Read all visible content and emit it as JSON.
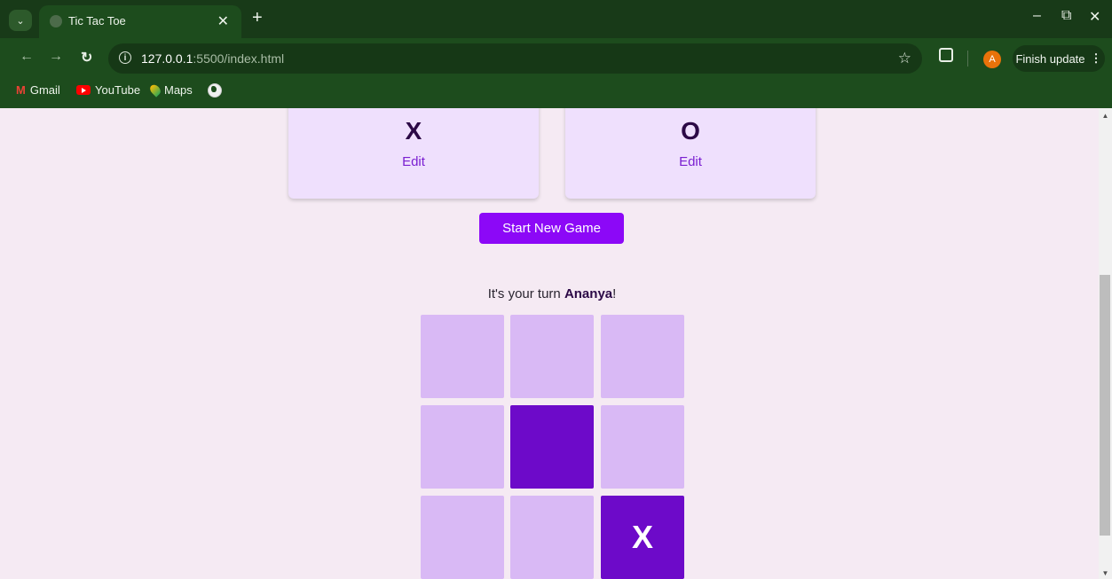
{
  "browser": {
    "tab_title": "Tic Tac Toe",
    "url_host": "127.0.0.1",
    "url_path": ":5500/index.html",
    "finish_update_label": "Finish update",
    "avatar_letter": "A",
    "bookmarks": [
      {
        "label": "Gmail",
        "icon": "gmail-icon"
      },
      {
        "label": "YouTube",
        "icon": "youtube-icon"
      },
      {
        "label": "Maps",
        "icon": "maps-icon"
      },
      {
        "label": "",
        "icon": "globe-icon"
      }
    ],
    "theme_color": "#1d4c1d"
  },
  "page": {
    "players": [
      {
        "symbol": "X",
        "edit_label": "Edit"
      },
      {
        "symbol": "O",
        "edit_label": "Edit"
      }
    ],
    "start_button_label": "Start New Game",
    "turn_prefix": "It's your turn ",
    "turn_player": "Ananya",
    "turn_suffix": "!",
    "board": [
      "",
      "",
      "",
      "",
      "",
      "",
      "",
      "",
      "X"
    ],
    "highlighted_cells": [
      4,
      8
    ],
    "accent_color": "#8c08f7"
  }
}
